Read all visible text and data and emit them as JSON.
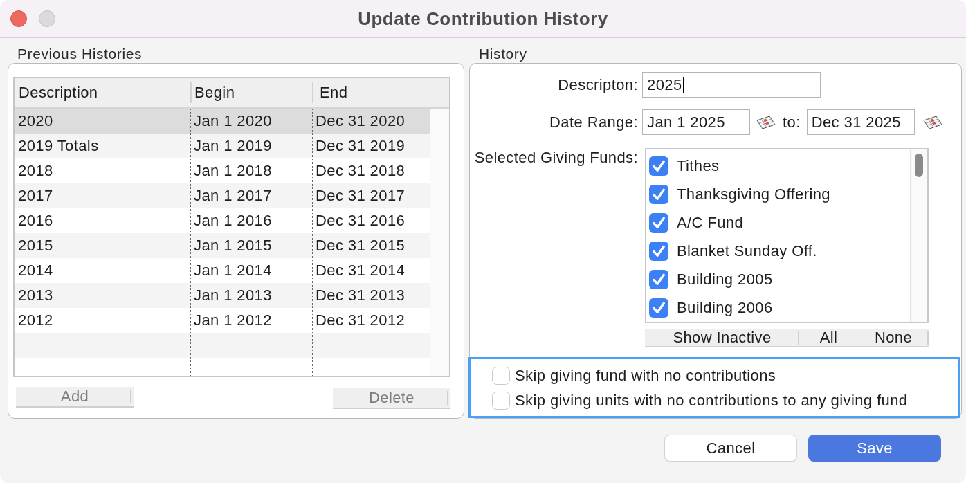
{
  "window": {
    "title": "Update Contribution History"
  },
  "previous_histories": {
    "title": "Previous Histories",
    "table": {
      "columns": [
        "Description",
        "Begin",
        "End"
      ],
      "rows": [
        {
          "cells": [
            "2020",
            "Jan 1 2020",
            "Dec 31 2020"
          ],
          "selected": true
        },
        {
          "cells": [
            "2019 Totals",
            "Jan 1 2019",
            "Dec 31 2019"
          ],
          "selected": false
        },
        {
          "cells": [
            "2018",
            "Jan 1 2018",
            "Dec 31 2018"
          ],
          "selected": false
        },
        {
          "cells": [
            "2017",
            "Jan 1 2017",
            "Dec 31 2017"
          ],
          "selected": false
        },
        {
          "cells": [
            "2016",
            "Jan 1 2016",
            "Dec 31 2016"
          ],
          "selected": false
        },
        {
          "cells": [
            "2015",
            "Jan 1 2015",
            "Dec 31 2015"
          ],
          "selected": false
        },
        {
          "cells": [
            "2014",
            "Jan 1 2014",
            "Dec 31 2014"
          ],
          "selected": false
        },
        {
          "cells": [
            "2013",
            "Jan 1 2013",
            "Dec 31 2013"
          ],
          "selected": false
        },
        {
          "cells": [
            "2012",
            "Jan 1 2012",
            "Dec 31 2012"
          ],
          "selected": false
        }
      ]
    },
    "buttons": [
      {
        "label": "Add",
        "disabled": true
      },
      {
        "label": "Delete",
        "disabled": true
      }
    ]
  },
  "history": {
    "title": "History",
    "description": {
      "label": "Descripton:",
      "value": "2025",
      "focused": true
    },
    "date_range": {
      "label": "Date Range:",
      "from": "Jan 1 2025",
      "separator": "to:",
      "to": "Dec 31 2025"
    },
    "funds": {
      "label": "Selected Giving Funds:",
      "items": [
        {
          "name": "Tithes",
          "checked": true
        },
        {
          "name": "Thanksgiving Offering",
          "checked": true
        },
        {
          "name": "A/C Fund",
          "checked": true
        },
        {
          "name": "Blanket Sunday Off.",
          "checked": true
        },
        {
          "name": "Building 2005",
          "checked": true
        },
        {
          "name": "Building 2006",
          "checked": true
        }
      ],
      "buttons": [
        "Show Inactive",
        "All",
        "None"
      ]
    },
    "options": {
      "highlighted": true,
      "items": [
        {
          "label": "Skip giving fund with no contributions",
          "checked": false
        },
        {
          "label": "Skip giving units with no contributions to any giving fund",
          "checked": false
        }
      ]
    }
  },
  "buttons": [
    {
      "label": "Cancel",
      "kind": "secondary"
    },
    {
      "label": "Save",
      "kind": "primary"
    }
  ]
}
